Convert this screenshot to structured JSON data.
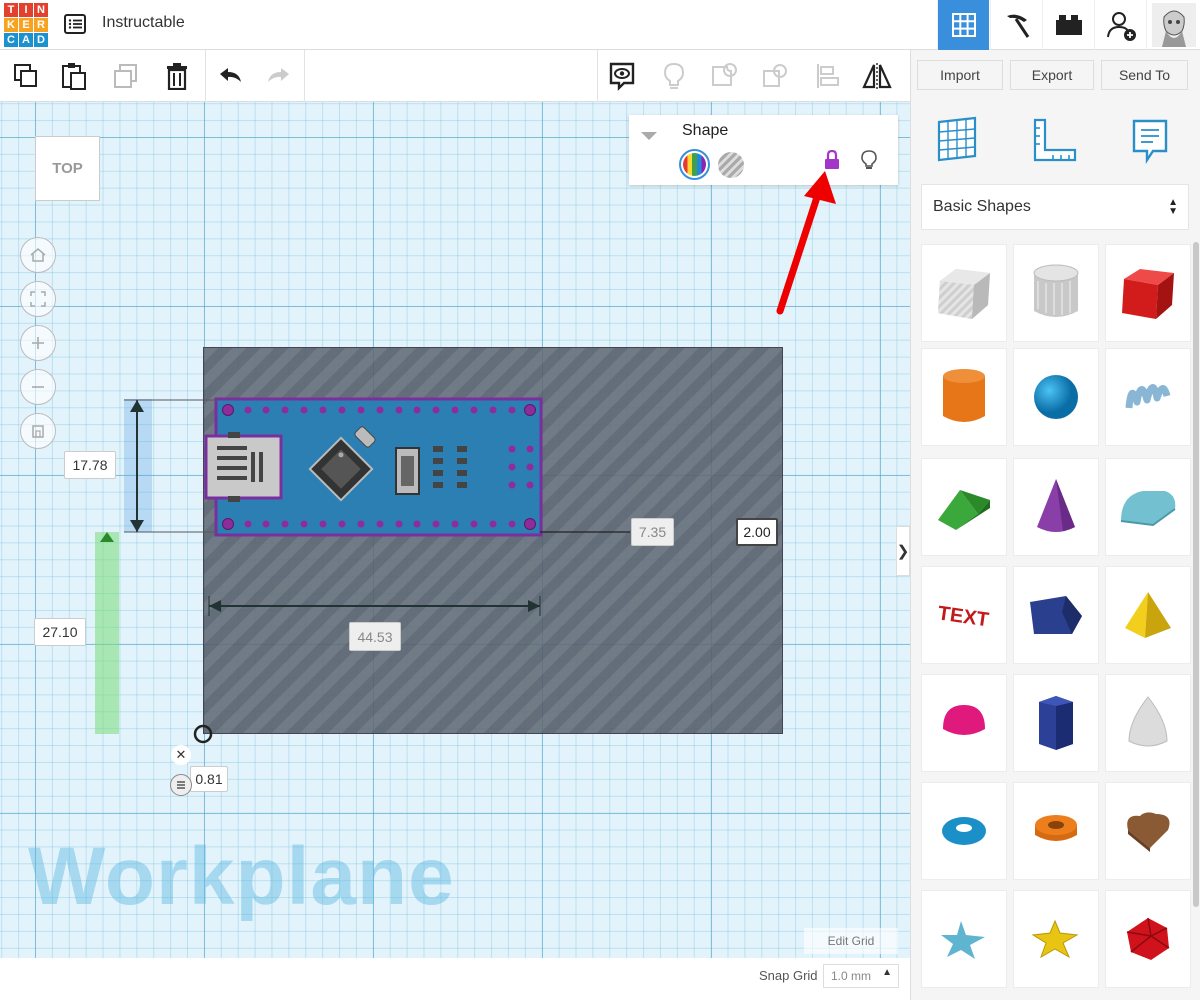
{
  "app": {
    "title": "Instructable",
    "logo_letters": [
      "T",
      "I",
      "N",
      "K",
      "E",
      "R",
      "C",
      "A",
      "D"
    ],
    "logo_colors": [
      "#e2412e",
      "#e2412e",
      "#e2412e",
      "#f6a321",
      "#f6a321",
      "#f6a321",
      "#1c91d0",
      "#1c91d0",
      "#1c91d0"
    ]
  },
  "topbar": {
    "icons": [
      "grid-view-icon",
      "pickaxe-icon",
      "bricks-icon",
      "add-user-icon",
      "avatar"
    ]
  },
  "toolbar": {
    "import_label": "Import",
    "export_label": "Export",
    "send_to_label": "Send To"
  },
  "inspector": {
    "title": "Shape"
  },
  "view_cube": {
    "label": "TOP"
  },
  "measurements": {
    "height_dim": "17.78",
    "y_offset": "27.10",
    "length": "44.53",
    "right_gap": "7.35",
    "width_input": "2.00",
    "elevation": "0.81"
  },
  "workplane": {
    "label": "Workplane",
    "edit_grid": "Edit Grid",
    "snap_grid_label": "Snap Grid",
    "snap_grid_value": "1.0 mm"
  },
  "library": {
    "category": "Basic Shapes",
    "shapes": [
      "Box hole",
      "Cylinder hole",
      "Box",
      "Cylinder",
      "Sphere",
      "Scribble",
      "Roof",
      "Cone",
      "Round Roof",
      "Text",
      "Wedge",
      "Pyramid",
      "Half Sphere",
      "Polygon",
      "Paraboloid",
      "Torus",
      "Tube",
      "Heart",
      "Star",
      "Star",
      "Icosahedron"
    ]
  },
  "colors": {
    "accent": "#3a8fdd",
    "solid": "#e53935",
    "arrow": "#ee0000"
  }
}
